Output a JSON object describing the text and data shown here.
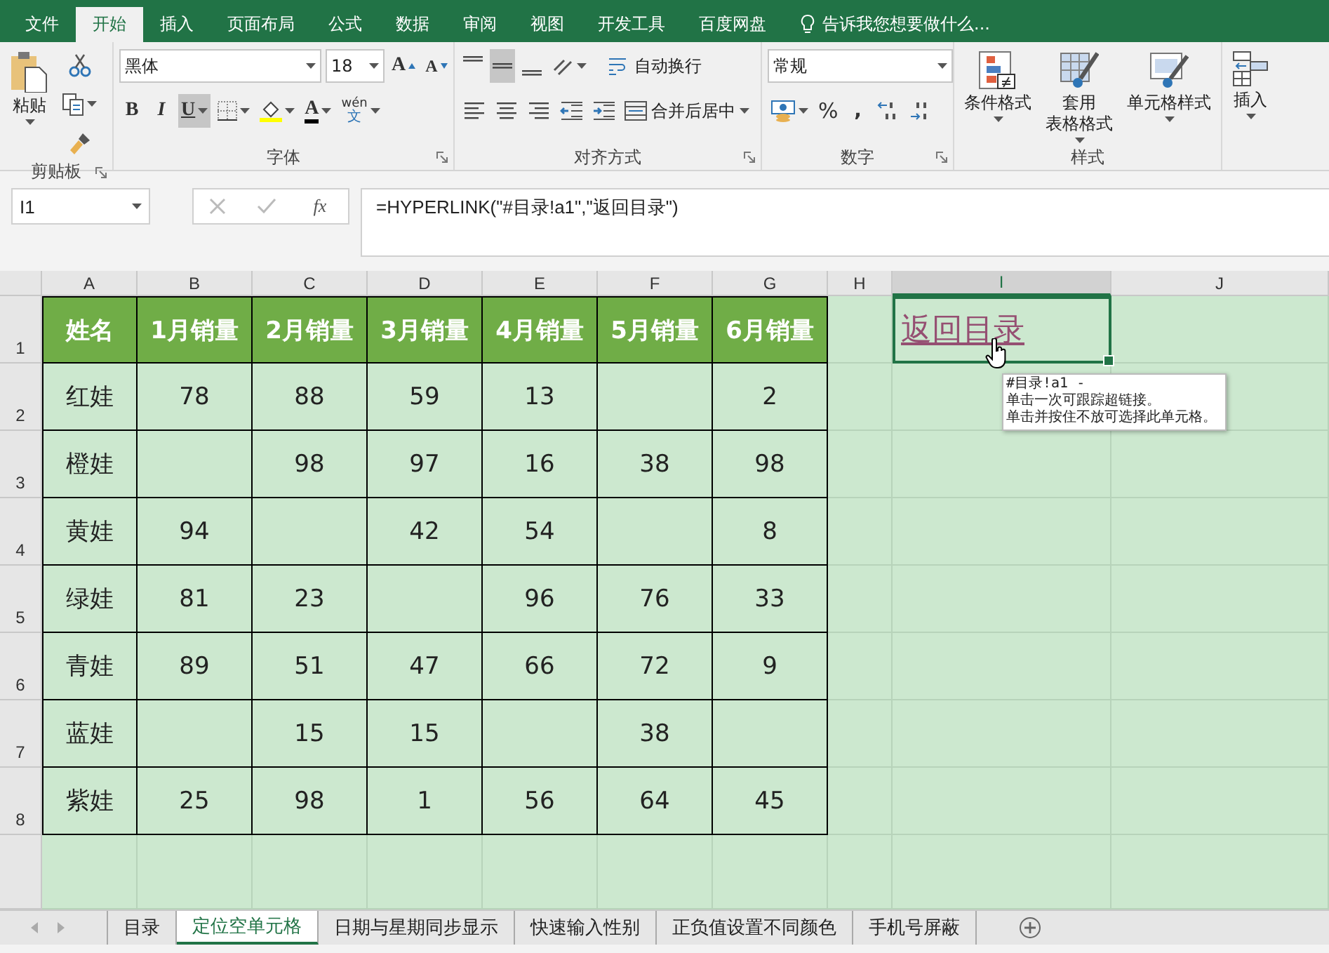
{
  "ribbon_tabs": [
    {
      "label": "文件",
      "selected": false
    },
    {
      "label": "开始",
      "selected": true
    },
    {
      "label": "插入",
      "selected": false
    },
    {
      "label": "页面布局",
      "selected": false
    },
    {
      "label": "公式",
      "selected": false
    },
    {
      "label": "数据",
      "selected": false
    },
    {
      "label": "审阅",
      "selected": false
    },
    {
      "label": "视图",
      "selected": false
    },
    {
      "label": "开发工具",
      "selected": false
    },
    {
      "label": "百度网盘",
      "selected": false
    }
  ],
  "tell_me": "告诉我您想要做什么...",
  "clipboard": {
    "label": "剪贴板",
    "launcher": true,
    "paste": "粘贴"
  },
  "font": {
    "label": "字体",
    "launcher": true,
    "name": "黑体",
    "size": "18",
    "grow": "A",
    "shrink": "A",
    "tools": [
      {
        "kind": "bold",
        "glyph": "B",
        "pressed": false
      },
      {
        "kind": "italic",
        "glyph": "I",
        "pressed": false
      },
      {
        "kind": "underline",
        "glyph": "U",
        "pressed": true
      },
      {
        "kind": "borders",
        "pressed": false
      },
      {
        "kind": "fill",
        "pressed": false
      },
      {
        "kind": "font-color",
        "glyph": "A",
        "pressed": false
      },
      {
        "kind": "phonetic",
        "glyph": "wén",
        "sub": "文",
        "pressed": false
      }
    ]
  },
  "alignment": {
    "label": "对齐方式",
    "launcher": true,
    "vertical": [
      {
        "kind": "top",
        "selected": false
      },
      {
        "kind": "middle",
        "selected": true
      },
      {
        "kind": "bottom",
        "selected": false
      }
    ],
    "horizontal": [
      {
        "kind": "left",
        "selected": false
      },
      {
        "kind": "center",
        "selected": false
      },
      {
        "kind": "right",
        "selected": false
      }
    ],
    "wrap": "自动换行",
    "merge": "合并后居中"
  },
  "number": {
    "label": "数字",
    "launcher": true,
    "format": "常规",
    "percent": "%",
    "comma": ","
  },
  "styles": {
    "label": "样式",
    "launcher": false,
    "buttons": [
      {
        "kind": "conditional",
        "lines": [
          "条件格式"
        ]
      },
      {
        "kind": "table",
        "lines": [
          "套用",
          "表格格式"
        ]
      },
      {
        "kind": "cell",
        "lines": [
          "单元格样式"
        ]
      }
    ]
  },
  "cells": {
    "insert": "插入"
  },
  "formula_bar": {
    "name_box": "I1",
    "fx": "fx",
    "formula": "=HYPERLINK(\"#目录!a1\",\"返回目录\")"
  },
  "columns": [
    {
      "label": "A",
      "selected": false
    },
    {
      "label": "B",
      "selected": false
    },
    {
      "label": "C",
      "selected": false
    },
    {
      "label": "D",
      "selected": false
    },
    {
      "label": "E",
      "selected": false
    },
    {
      "label": "F",
      "selected": false
    },
    {
      "label": "G",
      "selected": false
    },
    {
      "label": "H",
      "selected": false
    },
    {
      "label": "I",
      "selected": true
    },
    {
      "label": "J",
      "selected": false
    }
  ],
  "rows": [
    "1",
    "2",
    "3",
    "4",
    "5",
    "6",
    "7",
    "8"
  ],
  "table": {
    "header": [
      "姓名",
      "1月销量",
      "2月销量",
      "3月销量",
      "4月销量",
      "5月销量",
      "6月销量"
    ],
    "rows": [
      [
        "红娃",
        "78",
        "88",
        "59",
        "13",
        null,
        "2"
      ],
      [
        "橙娃",
        null,
        "98",
        "97",
        "16",
        "38",
        "98"
      ],
      [
        "黄娃",
        "94",
        null,
        "42",
        "54",
        null,
        "8"
      ],
      [
        "绿娃",
        "81",
        "23",
        null,
        "96",
        "76",
        "33"
      ],
      [
        "青娃",
        "89",
        "51",
        "47",
        "66",
        "72",
        "9"
      ],
      [
        "蓝娃",
        null,
        "15",
        "15",
        null,
        "38",
        null
      ],
      [
        "紫娃",
        "25",
        "98",
        "1",
        "56",
        "64",
        "45"
      ]
    ]
  },
  "link_cell": {
    "text": "返回目录",
    "selected": true
  },
  "tooltip": {
    "lines": [
      "#目录!a1 -",
      "单击一次可跟踪超链接。",
      "单击并按住不放可选择此单元格。"
    ]
  },
  "sheet_tabs": [
    {
      "label": "目录",
      "selected": false
    },
    {
      "label": "定位空单元格",
      "selected": true
    },
    {
      "label": "日期与星期同步显示",
      "selected": false
    },
    {
      "label": "快速输入性别",
      "selected": false
    },
    {
      "label": "正负值设置不同颜色",
      "selected": false
    },
    {
      "label": "手机号屏蔽",
      "selected": false
    }
  ]
}
